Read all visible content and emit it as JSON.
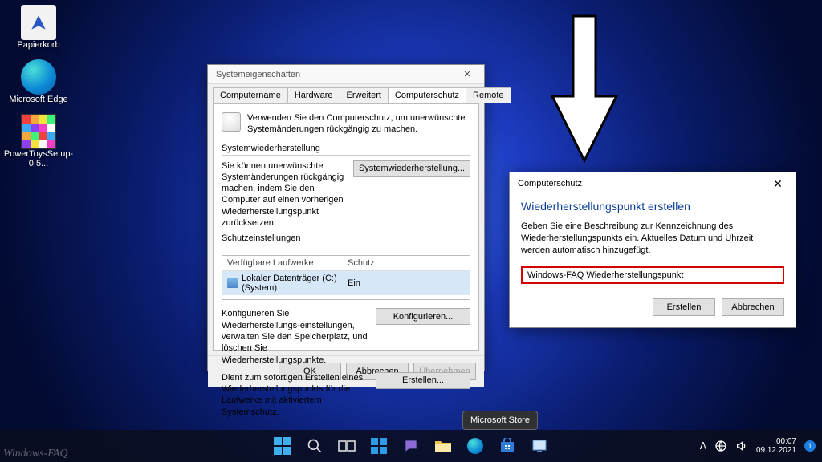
{
  "desktop": {
    "icons": [
      {
        "label": "Papierkorb"
      },
      {
        "label": "Microsoft Edge"
      },
      {
        "label": "PowerToysSetup-0.5..."
      }
    ]
  },
  "system_props": {
    "title": "Systemeigenschaften",
    "tabs": [
      "Computername",
      "Hardware",
      "Erweitert",
      "Computerschutz",
      "Remote"
    ],
    "active_tab": 3,
    "intro": "Verwenden Sie den Computerschutz, um unerwünschte Systemänderungen rückgängig zu machen.",
    "restore": {
      "title": "Systemwiederherstellung",
      "text": "Sie können unerwünschte Systemänderungen rückgängig machen, indem Sie den Computer auf einen vorherigen Wiederherstellungspunkt zurücksetzen.",
      "button": "Systemwiederherstellung..."
    },
    "settings": {
      "title": "Schutzeinstellungen",
      "col_drive": "Verfügbare Laufwerke",
      "col_prot": "Schutz",
      "drive_name": "Lokaler Datenträger (C:) (System)",
      "drive_prot": "Ein",
      "configure_text": "Konfigurieren Sie Wiederherstellungs-einstellungen, verwalten Sie den Speicherplatz, und löschen Sie Wiederherstellungspunkte.",
      "configure_btn": "Konfigurieren...",
      "create_text": "Dient zum sofortigen Erstellen eines Wiederherstellungspunkts für die Laufwerke mit aktiviertem Systemschutz.",
      "create_btn": "Erstellen..."
    },
    "footer": {
      "ok": "OK",
      "cancel": "Abbrechen",
      "apply": "Übernehmen"
    }
  },
  "restore_dialog": {
    "title": "Computerschutz",
    "heading": "Wiederherstellungspunkt erstellen",
    "desc": "Geben Sie eine Beschreibung zur Kennzeichnung des Wiederherstellungspunkts ein. Aktuelles Datum und Uhrzeit werden automatisch hinzugefügt.",
    "input_value": "Windows-FAQ Wiederherstellungspunkt",
    "create": "Erstellen",
    "cancel": "Abbrechen"
  },
  "tooltip": "Microsoft Store",
  "taskbar": {
    "time": "00:07",
    "date": "09.12.2021",
    "notif_count": "1"
  },
  "watermark": "Windows-FAQ"
}
